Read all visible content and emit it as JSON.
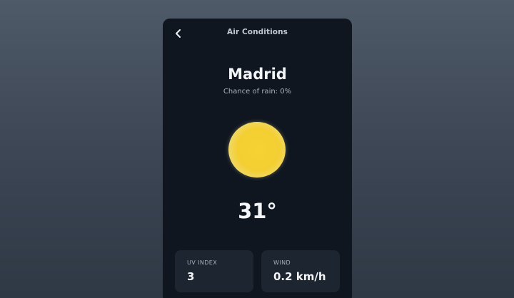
{
  "header": {
    "title": "Air Conditions",
    "back_icon": "chevron-left-icon"
  },
  "location": {
    "city": "Madrid",
    "rain_chance": "Chance of rain: 0%"
  },
  "weather": {
    "icon": "sun-icon",
    "temperature": "31°"
  },
  "metrics": {
    "uv": {
      "label": "UV INDEX",
      "value": "3"
    },
    "wind": {
      "label": "WIND",
      "value": "0.2 km/h"
    }
  },
  "colors": {
    "background": "#3e4856",
    "panel": "#0f1620",
    "card": "#1d2531",
    "sun": "#f4cf33"
  }
}
